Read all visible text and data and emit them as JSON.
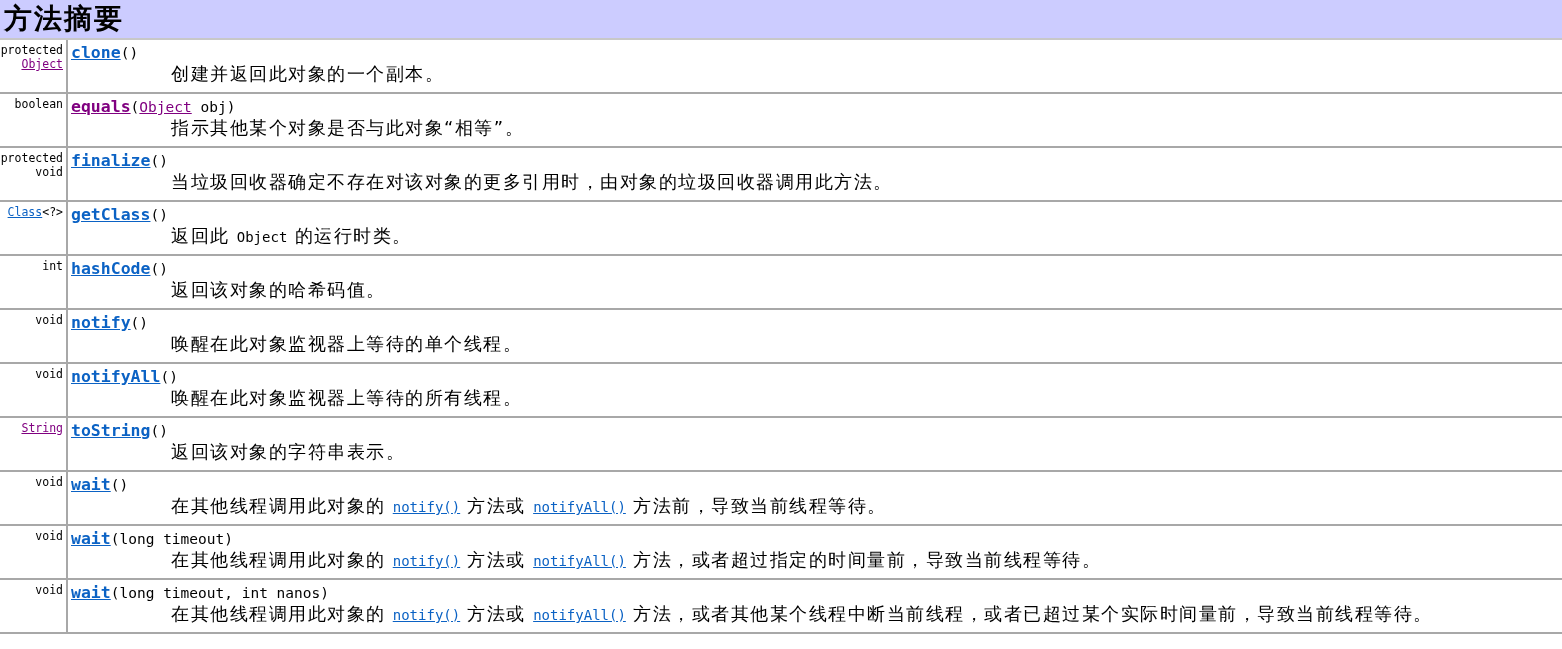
{
  "title": "方法摘要",
  "rows": [
    {
      "modifier": [
        {
          "kind": "text",
          "text": "protected "
        },
        {
          "kind": "link",
          "text": "Object",
          "visited": true
        }
      ],
      "name": "clone",
      "visited": false,
      "params": [
        {
          "kind": "text",
          "text": "()"
        }
      ],
      "description": [
        {
          "kind": "text",
          "text": "创建并返回此对象的一个副本。"
        }
      ]
    },
    {
      "modifier": [
        {
          "kind": "text",
          "text": "boolean"
        }
      ],
      "name": "equals",
      "visited": true,
      "params": [
        {
          "kind": "text",
          "text": "("
        },
        {
          "kind": "link",
          "text": "Object",
          "visited": true
        },
        {
          "kind": "text",
          "text": " obj)"
        }
      ],
      "description": [
        {
          "kind": "text",
          "text": "指示其他某个对象是否与此对象“相等”。"
        }
      ]
    },
    {
      "modifier": [
        {
          "kind": "text",
          "text": "protected void"
        }
      ],
      "name": "finalize",
      "visited": false,
      "params": [
        {
          "kind": "text",
          "text": "()"
        }
      ],
      "description": [
        {
          "kind": "text",
          "text": "当垃圾回收器确定不存在对该对象的更多引用时，由对象的垃圾回收器调用此方法。"
        }
      ]
    },
    {
      "modifier": [
        {
          "kind": "link",
          "text": "Class",
          "visited": false
        },
        {
          "kind": "text",
          "text": "<?>"
        }
      ],
      "name": "getClass",
      "visited": false,
      "params": [
        {
          "kind": "text",
          "text": "()"
        }
      ],
      "description": [
        {
          "kind": "text",
          "text": "返回此 "
        },
        {
          "kind": "code",
          "text": "Object"
        },
        {
          "kind": "text",
          "text": " 的运行时类。"
        }
      ]
    },
    {
      "modifier": [
        {
          "kind": "text",
          "text": "int"
        }
      ],
      "name": "hashCode",
      "visited": false,
      "params": [
        {
          "kind": "text",
          "text": "()"
        }
      ],
      "description": [
        {
          "kind": "text",
          "text": "返回该对象的哈希码值。"
        }
      ]
    },
    {
      "modifier": [
        {
          "kind": "text",
          "text": "void"
        }
      ],
      "name": "notify",
      "visited": false,
      "params": [
        {
          "kind": "text",
          "text": "()"
        }
      ],
      "description": [
        {
          "kind": "text",
          "text": "唤醒在此对象监视器上等待的单个线程。"
        }
      ]
    },
    {
      "modifier": [
        {
          "kind": "text",
          "text": "void"
        }
      ],
      "name": "notifyAll",
      "visited": false,
      "params": [
        {
          "kind": "text",
          "text": "()"
        }
      ],
      "description": [
        {
          "kind": "text",
          "text": "唤醒在此对象监视器上等待的所有线程。"
        }
      ]
    },
    {
      "modifier": [
        {
          "kind": "link",
          "text": "String",
          "visited": true
        }
      ],
      "name": "toString",
      "visited": false,
      "params": [
        {
          "kind": "text",
          "text": "()"
        }
      ],
      "description": [
        {
          "kind": "text",
          "text": "返回该对象的字符串表示。"
        }
      ]
    },
    {
      "modifier": [
        {
          "kind": "text",
          "text": "void"
        }
      ],
      "name": "wait",
      "visited": false,
      "params": [
        {
          "kind": "text",
          "text": "()"
        }
      ],
      "description": [
        {
          "kind": "text",
          "text": "在其他线程调用此对象的 "
        },
        {
          "kind": "link",
          "text": "notify()",
          "visited": false
        },
        {
          "kind": "text",
          "text": " 方法或 "
        },
        {
          "kind": "link",
          "text": "notifyAll()",
          "visited": false
        },
        {
          "kind": "text",
          "text": " 方法前，导致当前线程等待。"
        }
      ]
    },
    {
      "modifier": [
        {
          "kind": "text",
          "text": "void"
        }
      ],
      "name": "wait",
      "visited": false,
      "params": [
        {
          "kind": "text",
          "text": "(long timeout)"
        }
      ],
      "description": [
        {
          "kind": "text",
          "text": "在其他线程调用此对象的 "
        },
        {
          "kind": "link",
          "text": "notify()",
          "visited": false
        },
        {
          "kind": "text",
          "text": " 方法或 "
        },
        {
          "kind": "link",
          "text": "notifyAll()",
          "visited": false
        },
        {
          "kind": "text",
          "text": " 方法，或者超过指定的时间量前，导致当前线程等待。"
        }
      ]
    },
    {
      "modifier": [
        {
          "kind": "text",
          "text": "void"
        }
      ],
      "name": "wait",
      "visited": false,
      "params": [
        {
          "kind": "text",
          "text": "(long timeout, int nanos)"
        }
      ],
      "description": [
        {
          "kind": "text",
          "text": "在其他线程调用此对象的 "
        },
        {
          "kind": "link",
          "text": "notify()",
          "visited": false
        },
        {
          "kind": "text",
          "text": " 方法或 "
        },
        {
          "kind": "link",
          "text": "notifyAll()",
          "visited": false
        },
        {
          "kind": "text",
          "text": " 方法，或者其他某个线程中断当前线程，或者已超过某个实际时间量前，导致当前线程等待。"
        }
      ]
    }
  ]
}
